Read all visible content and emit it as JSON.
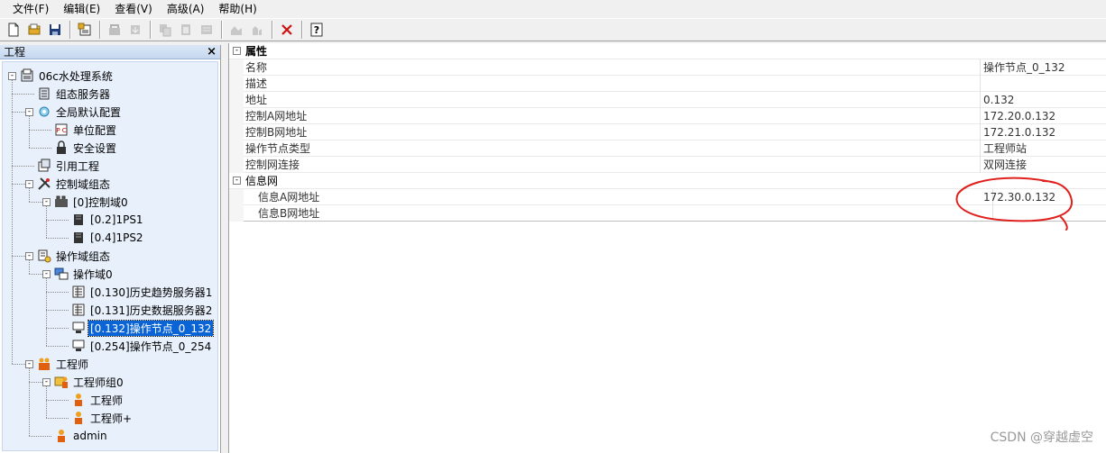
{
  "menu": [
    "文件(F)",
    "编辑(E)",
    "查看(V)",
    "高级(A)",
    "帮助(H)"
  ],
  "toolbar": {
    "icons": [
      "new-icon",
      "open-icon",
      "save-icon",
      "properties-icon",
      "build-icon",
      "download-icon",
      "copy-icon",
      "paste-icon",
      "duplicate-icon",
      "upload-icon",
      "compile-icon",
      "delete-icon",
      "help-icon"
    ]
  },
  "project_pane": {
    "title": "工程",
    "close": "×",
    "tree": [
      {
        "label": "06c水处理系统",
        "level": 0,
        "toggle": "-",
        "icon": "project-icon"
      },
      {
        "label": "组态服务器",
        "level": 1,
        "toggle": "",
        "icon": "server-icon"
      },
      {
        "label": "全局默认配置",
        "level": 1,
        "toggle": "-",
        "icon": "settings-icon"
      },
      {
        "label": "单位配置",
        "level": 2,
        "toggle": "",
        "icon": "unit-config-icon"
      },
      {
        "label": "安全设置",
        "level": 2,
        "toggle": "",
        "icon": "lock-icon"
      },
      {
        "label": "引用工程",
        "level": 1,
        "toggle": "",
        "icon": "reference-icon"
      },
      {
        "label": "控制域组态",
        "level": 1,
        "toggle": "-",
        "icon": "tools-icon"
      },
      {
        "label": "[0]控制域0",
        "level": 2,
        "toggle": "-",
        "icon": "control-domain-icon"
      },
      {
        "label": "[0.2]1PS1",
        "level": 3,
        "toggle": "",
        "icon": "controller-icon"
      },
      {
        "label": "[0.4]1PS2",
        "level": 3,
        "toggle": "",
        "icon": "controller-icon"
      },
      {
        "label": "操作域组态",
        "level": 1,
        "toggle": "-",
        "icon": "operation-config-icon"
      },
      {
        "label": "操作域0",
        "level": 2,
        "toggle": "-",
        "icon": "operation-domain-icon"
      },
      {
        "label": "[0.130]历史趋势服务器1",
        "level": 3,
        "toggle": "",
        "icon": "history-server-icon"
      },
      {
        "label": "[0.131]历史数据服务器2",
        "level": 3,
        "toggle": "",
        "icon": "history-server-icon"
      },
      {
        "label": "[0.132]操作节点_0_132",
        "level": 3,
        "toggle": "",
        "icon": "workstation-icon",
        "selected": true
      },
      {
        "label": "[0.254]操作节点_0_254",
        "level": 3,
        "toggle": "",
        "icon": "workstation-icon"
      },
      {
        "label": "工程师",
        "level": 1,
        "toggle": "-",
        "icon": "engineers-icon"
      },
      {
        "label": "工程师组0",
        "level": 2,
        "toggle": "-",
        "icon": "engineer-group-icon"
      },
      {
        "label": "工程师",
        "level": 3,
        "toggle": "",
        "icon": "engineer-icon"
      },
      {
        "label": "工程师+",
        "level": 3,
        "toggle": "",
        "icon": "engineer-icon"
      },
      {
        "label": "admin",
        "level": 2,
        "toggle": "",
        "icon": "engineer-icon"
      }
    ]
  },
  "properties": {
    "group_title": "属性",
    "rows": [
      {
        "name": "名称",
        "value": "操作节点_0_132"
      },
      {
        "name": "描述",
        "value": ""
      },
      {
        "name": "地址",
        "value": "0.132"
      },
      {
        "name": "控制A网地址",
        "value": "172.20.0.132"
      },
      {
        "name": "控制B网地址",
        "value": "172.21.0.132"
      },
      {
        "name": "操作节点类型",
        "value": "工程师站"
      },
      {
        "name": "控制网连接",
        "value": "双网连接"
      }
    ],
    "subgroup_title": "信息网",
    "sub_rows": [
      {
        "name": "信息A网地址",
        "value": "172.30.0.132"
      },
      {
        "name": "信息B网地址",
        "value": ""
      }
    ]
  },
  "annotation_color": "#e0201c",
  "watermark": "CSDN @穿越虚空"
}
